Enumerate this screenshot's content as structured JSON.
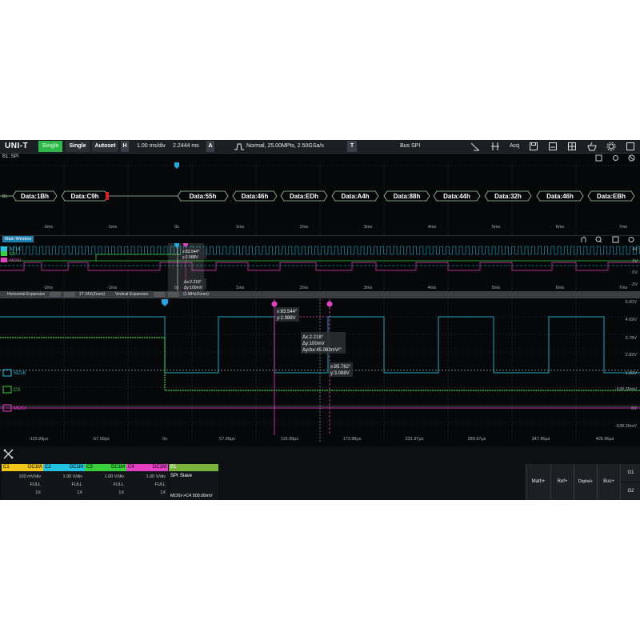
{
  "topbar": {
    "logo": "UNI-T",
    "status_badge": "Single",
    "single_label": "Single",
    "autoset_label": "Autoset",
    "h_label": "H",
    "timebase": "1.00 ms/div",
    "position": "2.2444 ms",
    "a_label": "A",
    "acq_info": "Normal,  25.00MPts,  2.50GSa/s",
    "t_label": "T",
    "bus_label": "Bus  SPI",
    "acq_button": "Acq"
  },
  "bus_window": {
    "label": "B1: SPI",
    "bus_tag": "B1",
    "packets": [
      "Data:1Bh",
      "Data:C9h",
      "Data:55h",
      "Data:46h",
      "Data:EDh",
      "Data:A4h",
      "Data:88h",
      "Data:44h",
      "Data:32h",
      "Data:46h",
      "Data:EBh"
    ],
    "time_ticks": [
      "-2ms",
      "-1ms",
      "0s",
      "1ms",
      "2ms",
      "3ms",
      "4ms",
      "5ms",
      "6ms",
      "7ms"
    ]
  },
  "main_window": {
    "label": "Main Window",
    "time_ticks": [
      "-2ms",
      "-1ms",
      "0s",
      "1ms",
      "2ms",
      "3ms",
      "4ms",
      "5ms",
      "6ms",
      "7ms"
    ],
    "volt_ticks": [
      "4V",
      "2V",
      "0V",
      "-2V"
    ],
    "cursor_x": "x:83.544°",
    "cursor_y": "y:2.988V",
    "cursor_dx": "Δx:2.218°",
    "cursor_dy": "Δy:100mV",
    "channel_labels": [
      "SCLK",
      "CS",
      "MOSI"
    ],
    "expansion_bar": {
      "horizontal": "Horizontal Expansion",
      "zoom": "1T 24X(Zoom)",
      "vertical": "Vertical Expansion",
      "vzoom": "(1.MHz/Zoom)"
    }
  },
  "zoom_window": {
    "cursor_a_x": "x:83.544°",
    "cursor_a_y": "y:2.988V",
    "delta_x": "Δx:2.218°",
    "delta_y": "Δy:100mV",
    "delta_ratio": "Δy/Δx:45.083mV/°",
    "cursor_b_x": "x:85.762°",
    "cursor_b_y": "y:3.088V",
    "volt_ticks": [
      "5.60V",
      "4.69V",
      "3.78V",
      "2.82V",
      "1.86V",
      "-538.36mV",
      "0V",
      "-538.36mV"
    ],
    "time_ticks": [
      "-115.99μs",
      "-57.99μs",
      "0s",
      "57.99μs",
      "115.99μs",
      "173.98μs",
      "231.97μs",
      "289.97μs",
      "347.96μs",
      "405.96μs"
    ],
    "channel_labels": [
      "SCLK",
      "CS",
      "MOSI"
    ]
  },
  "channels": [
    {
      "id": "C1",
      "coupling": "DC1M",
      "scale": "100 mV/div",
      "bw": "FULL",
      "probe": "1X",
      "color": "#f0c419"
    },
    {
      "id": "C2",
      "coupling": "DC1M",
      "scale": "1.00 V/div",
      "bw": "FULL",
      "probe": "1X",
      "color": "#22c1e0"
    },
    {
      "id": "C3",
      "coupling": "DC1M",
      "scale": "1.00 V/div",
      "bw": "FULL",
      "probe": "1X",
      "color": "#38d03a"
    },
    {
      "id": "C4",
      "coupling": "DC1M",
      "scale": "1.00 V/div",
      "bw": "FULL",
      "probe": "1X",
      "color": "#e53fc4"
    }
  ],
  "bus_panel": {
    "id": "B1",
    "protocol": "SPI",
    "mode": "Slave",
    "source": "MOSI->C4 500.00mV",
    "color": "#7ab33b"
  },
  "right_buttons": [
    "Math+",
    "Ref+",
    "Digital+",
    "Bus+"
  ],
  "g_buttons": [
    "G1",
    "G2"
  ],
  "colors": {
    "sclk": "#22c1e0",
    "cs": "#38d03a",
    "mosi": "#e53fc4",
    "cursor": "#e53fc4",
    "bus": "#a8c8a8",
    "background": "#050709"
  }
}
